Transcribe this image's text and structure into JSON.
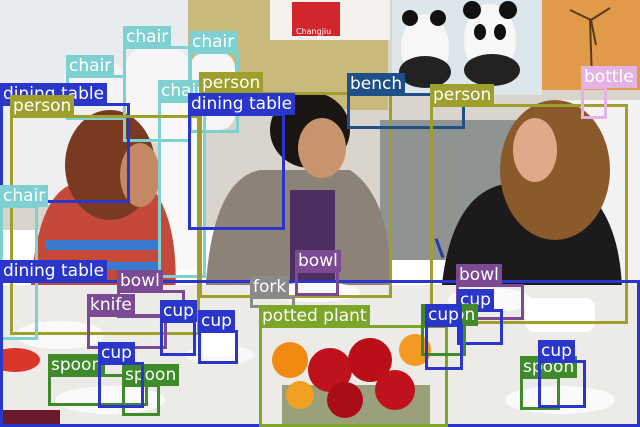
{
  "scene": {
    "banner_text": "Changjiu",
    "colors": {
      "wall": "#d9d4cc",
      "tablecloth": "#ecebe8",
      "floor_carpet": "#8f9391",
      "jacket_grey": "#8d8277",
      "blouse_purple": "#4d2e63",
      "top_black": "#1c1a1d",
      "roses_red": "#c0121c",
      "lilies_orange": "#f28a12"
    }
  },
  "detections": [
    {
      "label": "chair",
      "color": "#7fd1d1"
    },
    {
      "label": "chair",
      "color": "#7fd1d1"
    },
    {
      "label": "chair",
      "color": "#7fd1d1"
    },
    {
      "label": "chair",
      "color": "#7fd1d1"
    },
    {
      "label": "person",
      "color": "#9e9f2c"
    },
    {
      "label": "bench",
      "color": "#1e4f86"
    },
    {
      "label": "person",
      "color": "#9e9f2c"
    },
    {
      "label": "bottle",
      "color": "#e3b3e3"
    },
    {
      "label": "dining table",
      "color": "#2a36c9"
    },
    {
      "label": "person",
      "color": "#9e9f2c"
    },
    {
      "label": "dining table",
      "color": "#2a36c9"
    },
    {
      "label": "chair",
      "color": "#7fd1d1"
    },
    {
      "label": "dining table",
      "color": "#2a36c9"
    },
    {
      "label": "bowl",
      "color": "#7b4a93"
    },
    {
      "label": "bowl",
      "color": "#7b4a93"
    },
    {
      "label": "fork",
      "color": "#8a8a8a"
    },
    {
      "label": "bowl",
      "color": "#7b4a93"
    },
    {
      "label": "cup",
      "color": "#2a36c9"
    },
    {
      "label": "knife",
      "color": "#7b4a93"
    },
    {
      "label": "cup",
      "color": "#2a36c9"
    },
    {
      "label": "cup",
      "color": "#2a36c9"
    },
    {
      "label": "potted plant",
      "color": "#7ca629"
    },
    {
      "label": "spoon",
      "color": "#3f8a2b"
    },
    {
      "label": "cup",
      "color": "#2a36c9"
    },
    {
      "label": "spoon",
      "color": "#3f8a2b"
    },
    {
      "label": "spoon",
      "color": "#3f8a2b"
    },
    {
      "label": "spoon",
      "color": "#3f8a2b"
    },
    {
      "label": "cup",
      "color": "#2a36c9"
    },
    {
      "label": "cup",
      "color": "#2a36c9"
    }
  ]
}
